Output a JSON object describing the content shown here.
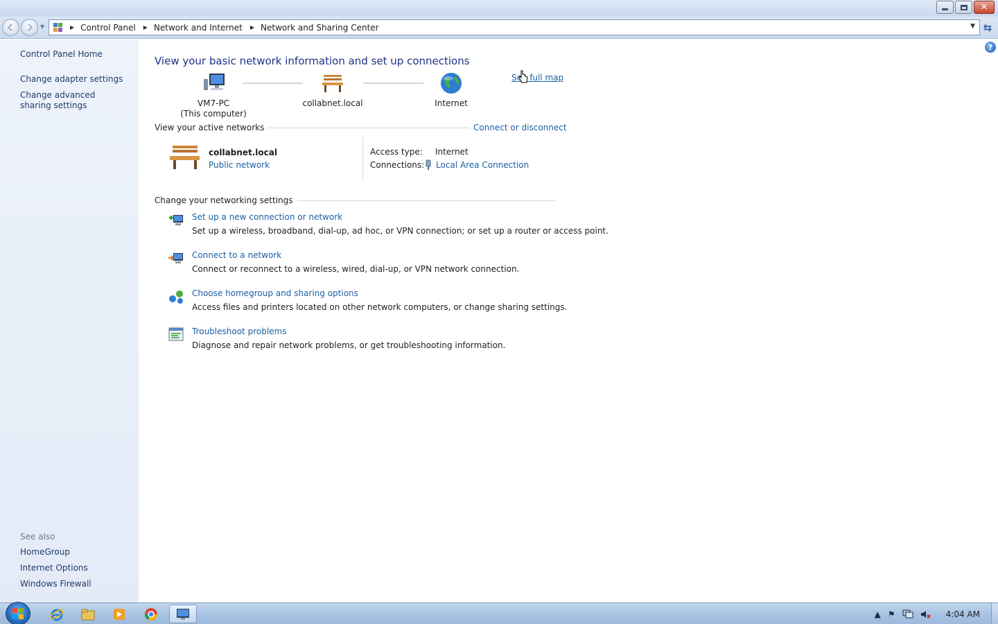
{
  "window": {
    "minimize_icon": "minimize-icon",
    "maximize_icon": "restore-icon",
    "close_icon": "close-icon",
    "close_glyph": "✕"
  },
  "address_bar": {
    "breadcrumbs": [
      "Control Panel",
      "Network and Internet",
      "Network and Sharing Center"
    ]
  },
  "left_pane": {
    "home": "Control Panel Home",
    "links": [
      "Change adapter settings",
      "Change advanced sharing settings"
    ],
    "see_also_title": "See also",
    "see_also": [
      "HomeGroup",
      "Internet Options",
      "Windows Firewall"
    ]
  },
  "main": {
    "heading": "View your basic network information and set up connections",
    "see_full_map": "See full map",
    "map": {
      "computer_name": "VM7-PC",
      "computer_sub": "(This computer)",
      "network_name": "collabnet.local",
      "internet": "Internet"
    },
    "active_networks": {
      "title": "View your active networks",
      "connect_link": "Connect or disconnect",
      "network_name": "collabnet.local",
      "network_type": "Public network",
      "access_type_label": "Access type:",
      "access_type_value": "Internet",
      "connections_label": "Connections:",
      "connections_value": "Local Area Connection"
    },
    "settings": {
      "title": "Change your networking settings",
      "tasks": [
        {
          "link": "Set up a new connection or network",
          "desc": "Set up a wireless, broadband, dial-up, ad hoc, or VPN connection; or set up a router or access point."
        },
        {
          "link": "Connect to a network",
          "desc": "Connect or reconnect to a wireless, wired, dial-up, or VPN network connection."
        },
        {
          "link": "Choose homegroup and sharing options",
          "desc": "Access files and printers located on other network computers, or change sharing settings."
        },
        {
          "link": "Troubleshoot problems",
          "desc": "Diagnose and repair network problems, or get troubleshooting information."
        }
      ]
    }
  },
  "taskbar": {
    "clock": "4:04 AM",
    "pinned": [
      "internet-explorer-icon",
      "windows-explorer-icon",
      "media-player-icon",
      "chrome-icon",
      "network-center-icon"
    ]
  },
  "colors": {
    "link": "#1b5ea5",
    "heading": "#1e3287",
    "left_pane_bg": "#e3ebf7"
  }
}
